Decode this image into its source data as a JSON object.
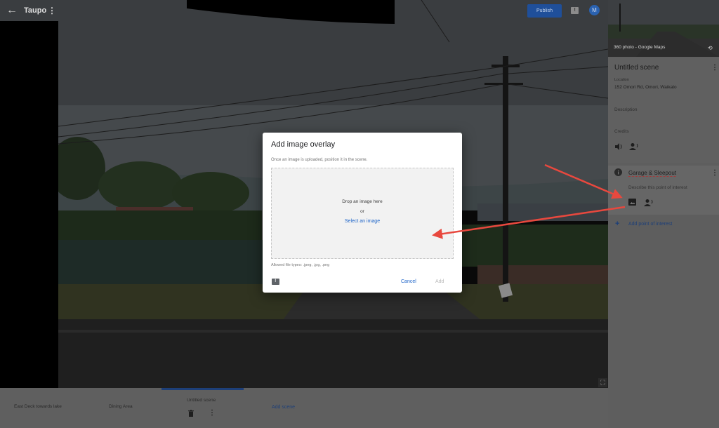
{
  "header": {
    "back_icon": "arrow-left-icon",
    "tour_title": "Taupo",
    "menu_icon": "more-vert-icon",
    "publish_label": "Publish",
    "feedback_icon": "feedback-icon",
    "avatar_letter": "M"
  },
  "right_panel": {
    "thumbnail_caption": "360 photo - Google Maps",
    "scene_title": "Untitled scene",
    "location_label": "Location",
    "location_value": "152 Omori Rd, Omori, Waikato",
    "description_label": "Description",
    "credits_label": "Credits",
    "poi": {
      "title": "Garage & Sleepout",
      "description_placeholder": "Describe this point of interest"
    },
    "add_poi_label": "Add point of interest"
  },
  "bottom_strip": {
    "scenes": [
      {
        "label": "East Deck towards lake"
      },
      {
        "label": "Dining Area"
      },
      {
        "label": "Untitled scene"
      }
    ],
    "add_scene_label": "Add scene"
  },
  "dialog": {
    "title": "Add image overlay",
    "subtitle": "Once an image is uploaded, position it in the scene.",
    "drop_text": "Drop an image here",
    "or_text": "or",
    "select_link": "Select an image",
    "allowed_types": "Allowed file types: .jpeg, .jpg, .png",
    "cancel_label": "Cancel",
    "add_label": "Add"
  },
  "colors": {
    "accent": "#1a73e8",
    "annotation_arrow": "#e8483e"
  }
}
